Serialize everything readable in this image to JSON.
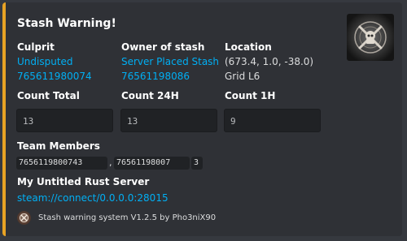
{
  "embed": {
    "accent_color": "#e8a324",
    "title": "Stash Warning!",
    "thumbnail_icon": "stash-emblem-icon",
    "culprit": {
      "name": "Culprit",
      "player": "Undisputed",
      "steam_id": "765611980074"
    },
    "owner": {
      "name": "Owner of stash",
      "player": "Server Placed Stash",
      "steam_id": "76561198086"
    },
    "location": {
      "name": "Location",
      "coords": "(673.4, 1.0, -38.0)",
      "grid": "Grid L6"
    },
    "counts": {
      "total": {
        "name": "Count Total",
        "value": "13"
      },
      "day": {
        "name": "Count 24H",
        "value": "13"
      },
      "hour": {
        "name": "Count 1H",
        "value": "9"
      }
    },
    "team": {
      "name": "Team Members",
      "members": [
        "7656119800743",
        "76561198007",
        "3"
      ]
    },
    "server": {
      "name": "My Untitled Rust Server",
      "connect": "steam://connect/0.0.0.0:28015"
    },
    "footer": {
      "icon": "author-avatar-icon",
      "text": "Stash warning system V1.2.5 by Pho3niX90"
    }
  }
}
